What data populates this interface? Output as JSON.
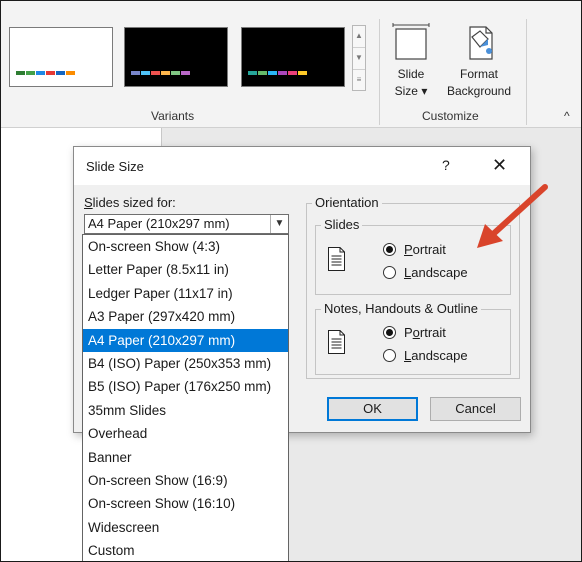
{
  "ribbon": {
    "variants_label": "Variants",
    "customize_label": "Customize",
    "slide_size_line1": "Slide",
    "slide_size_line2": "Size ▾",
    "format_bg_line1": "Format",
    "format_bg_line2": "Background",
    "collapse_glyph": "^"
  },
  "variant_palette": {
    "white_theme": [
      "#2e7d32",
      "#43a047",
      "#1e88e5",
      "#e53935",
      "#1565c0",
      "#fb8c00"
    ],
    "dark_theme_1": [
      "#7986cb",
      "#4fc3f7",
      "#ef5350",
      "#ffb74d",
      "#81c784",
      "#ba68c8"
    ],
    "dark_theme_2": [
      "#26a69a",
      "#66bb6a",
      "#29b6f6",
      "#ab47bc",
      "#ec407a",
      "#ffca28"
    ]
  },
  "dialog": {
    "title": "Slide Size",
    "help": "?",
    "close": "✕",
    "sized_for_first": "S",
    "sized_for_rest": "lides sized for:",
    "selected_size": "A4 Paper (210x297 mm)",
    "orientation_label": "Orientation",
    "slides_label": "Slides",
    "portrait_u": "P",
    "portrait_rest": "ortrait",
    "landscape_u": "L",
    "landscape_rest": "andscape",
    "notes_label": "Notes, Handouts & Outline",
    "notes_portrait_first": "P",
    "notes_portrait_u": "o",
    "notes_portrait_rest": "rtrait",
    "notes_landscape_u": "L",
    "notes_landscape_rest": "andscape",
    "ok": "OK",
    "cancel": "Cancel"
  },
  "size_options": [
    "On-screen Show (4:3)",
    "Letter Paper (8.5x11 in)",
    "Ledger Paper (11x17 in)",
    "A3 Paper (297x420 mm)",
    "A4 Paper (210x297 mm)",
    "B4 (ISO) Paper (250x353 mm)",
    "B5 (ISO) Paper (176x250 mm)",
    "35mm Slides",
    "Overhead",
    "Banner",
    "On-screen Show (16:9)",
    "On-screen Show (16:10)",
    "Widescreen",
    "Custom"
  ],
  "selected_index": 4,
  "annotation_color": "#d9442b"
}
